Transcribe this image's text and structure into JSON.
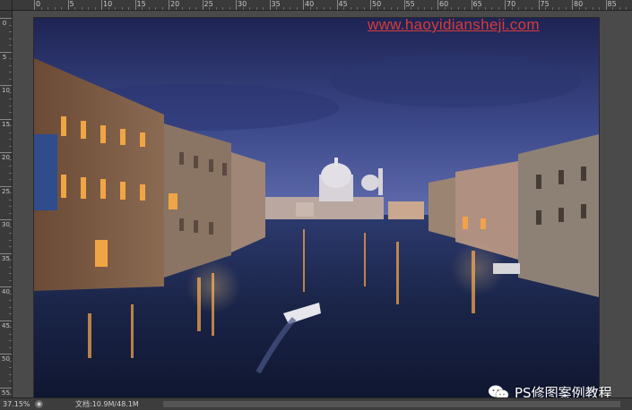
{
  "watermark": {
    "url": "www.haoyidiansheji.com"
  },
  "brand": {
    "text": "PS修图案例教程",
    "icon": "wechat-icon"
  },
  "ruler": {
    "top_labels": [
      "0",
      "5",
      "10",
      "15",
      "20",
      "25",
      "30",
      "35",
      "40",
      "45",
      "50",
      "55",
      "60",
      "65",
      "70",
      "75",
      "80",
      "85"
    ],
    "left_labels": [
      "0",
      "5",
      "10",
      "15",
      "20",
      "25",
      "30",
      "35",
      "40",
      "45",
      "50",
      "55"
    ]
  },
  "status": {
    "zoom": "37.15%",
    "doc_label": "文档:10.9M/48.1M",
    "arrow_icon": "play-triangle-icon"
  },
  "photo": {
    "subject": "venice-grand-canal-night",
    "colors": {
      "sky_top": "#2a3368",
      "sky_bottom": "#4d5aa0",
      "water": "#1b2546",
      "lights": "#f2a24a"
    }
  }
}
